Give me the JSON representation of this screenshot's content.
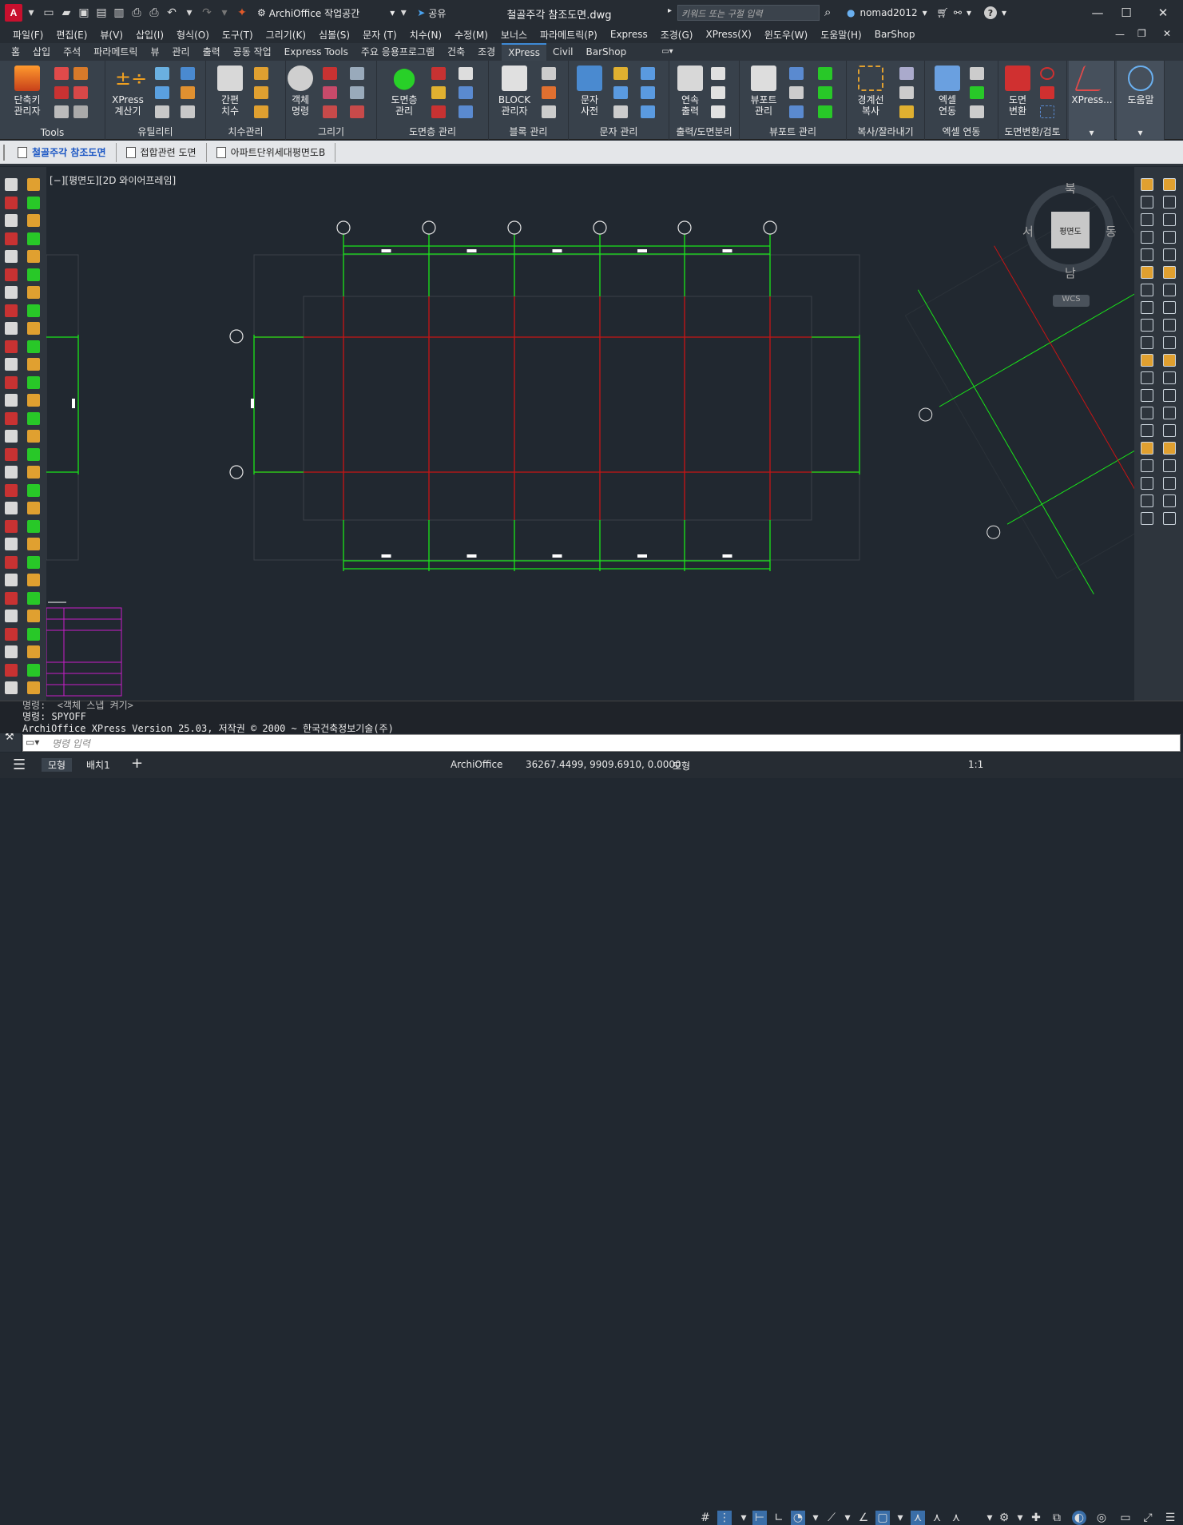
{
  "app": {
    "workspace": "ArchiOffice 작업공간",
    "share_label": "공유",
    "doc_title": "철골주각 참조도면.dwg",
    "search_placeholder": "키워드 또는 구절 입력",
    "user": "nomad2012"
  },
  "menus": [
    "파일(F)",
    "편집(E)",
    "뷰(V)",
    "삽입(I)",
    "형식(O)",
    "도구(T)",
    "그리기(K)",
    "심볼(S)",
    "문자 (T)",
    "치수(N)",
    "수정(M)",
    "보너스",
    "파라메트릭(P)",
    "Express",
    "조경(G)",
    "XPress(X)",
    "윈도우(W)",
    "도움말(H)",
    "BarShop"
  ],
  "ribbon_tabs": [
    "홈",
    "삽입",
    "주석",
    "파라메트릭",
    "뷰",
    "관리",
    "출력",
    "공동 작업",
    "Express Tools",
    "주요 응용프로그램",
    "건축",
    "조경",
    "XPress",
    "Civil",
    "BarShop"
  ],
  "active_tab": "XPress",
  "ribbon_panels": [
    {
      "label": "Tools",
      "buttons": [
        "단축키\n관리자"
      ]
    },
    {
      "label": "유틸리티",
      "buttons": [
        "XPress\n계산기"
      ]
    },
    {
      "label": "치수관리",
      "buttons": [
        "간편\n치수"
      ]
    },
    {
      "label": "그리기",
      "buttons": [
        "객체\n명령"
      ]
    },
    {
      "label": "도면층 관리",
      "buttons": [
        "도면층\n관리"
      ]
    },
    {
      "label": "블록 관리",
      "buttons": [
        "BLOCK\n관리자"
      ]
    },
    {
      "label": "문자 관리",
      "buttons": [
        "문자\n사전"
      ]
    },
    {
      "label": "출력/도면분리",
      "buttons": [
        "연속\n출력"
      ]
    },
    {
      "label": "뷰포트 관리",
      "buttons": [
        "뷰포트\n관리"
      ]
    },
    {
      "label": "복사/잘라내기",
      "buttons": [
        "경계선\n복사"
      ]
    },
    {
      "label": "엑셀 연동",
      "buttons": [
        "엑셀\n연동"
      ]
    },
    {
      "label": "도면변환/검토",
      "buttons": [
        "도면\n변환"
      ]
    },
    {
      "label": "",
      "buttons": [
        "XPress..."
      ]
    },
    {
      "label": "",
      "buttons": [
        "도움말"
      ]
    }
  ],
  "file_tabs": [
    {
      "label": "철골주각 참조도면",
      "active": true
    },
    {
      "label": "접합관련 도면",
      "active": false
    },
    {
      "label": "아파트단위세대평면도B",
      "active": false
    }
  ],
  "viewport_label": "[−][평면도][2D 와이어프레임]",
  "viewcube": {
    "north": "북",
    "south": "남",
    "east": "동",
    "west": "서",
    "face": "평면도",
    "wcs": "WCS"
  },
  "command_history": [
    "명령:  <객체 스냅 켜기>",
    "명령: SPYOFF",
    "ArchiOffice XPress Version 25.03, 저작권 © 2000 ~ 한국건축정보기술(주)"
  ],
  "command_placeholder": "명령 입력",
  "status": {
    "model_tab": "모형",
    "layout_tab": "배치1",
    "add": "+",
    "app_name": "ArchiOffice",
    "coords": "36267.4499, 9909.6910, 0.0000",
    "space": "모형",
    "scale": "1:1"
  },
  "colors": {
    "green": "#19e619",
    "red": "#c81414",
    "magenta": "#c81ec8",
    "canvas": "#212830"
  }
}
